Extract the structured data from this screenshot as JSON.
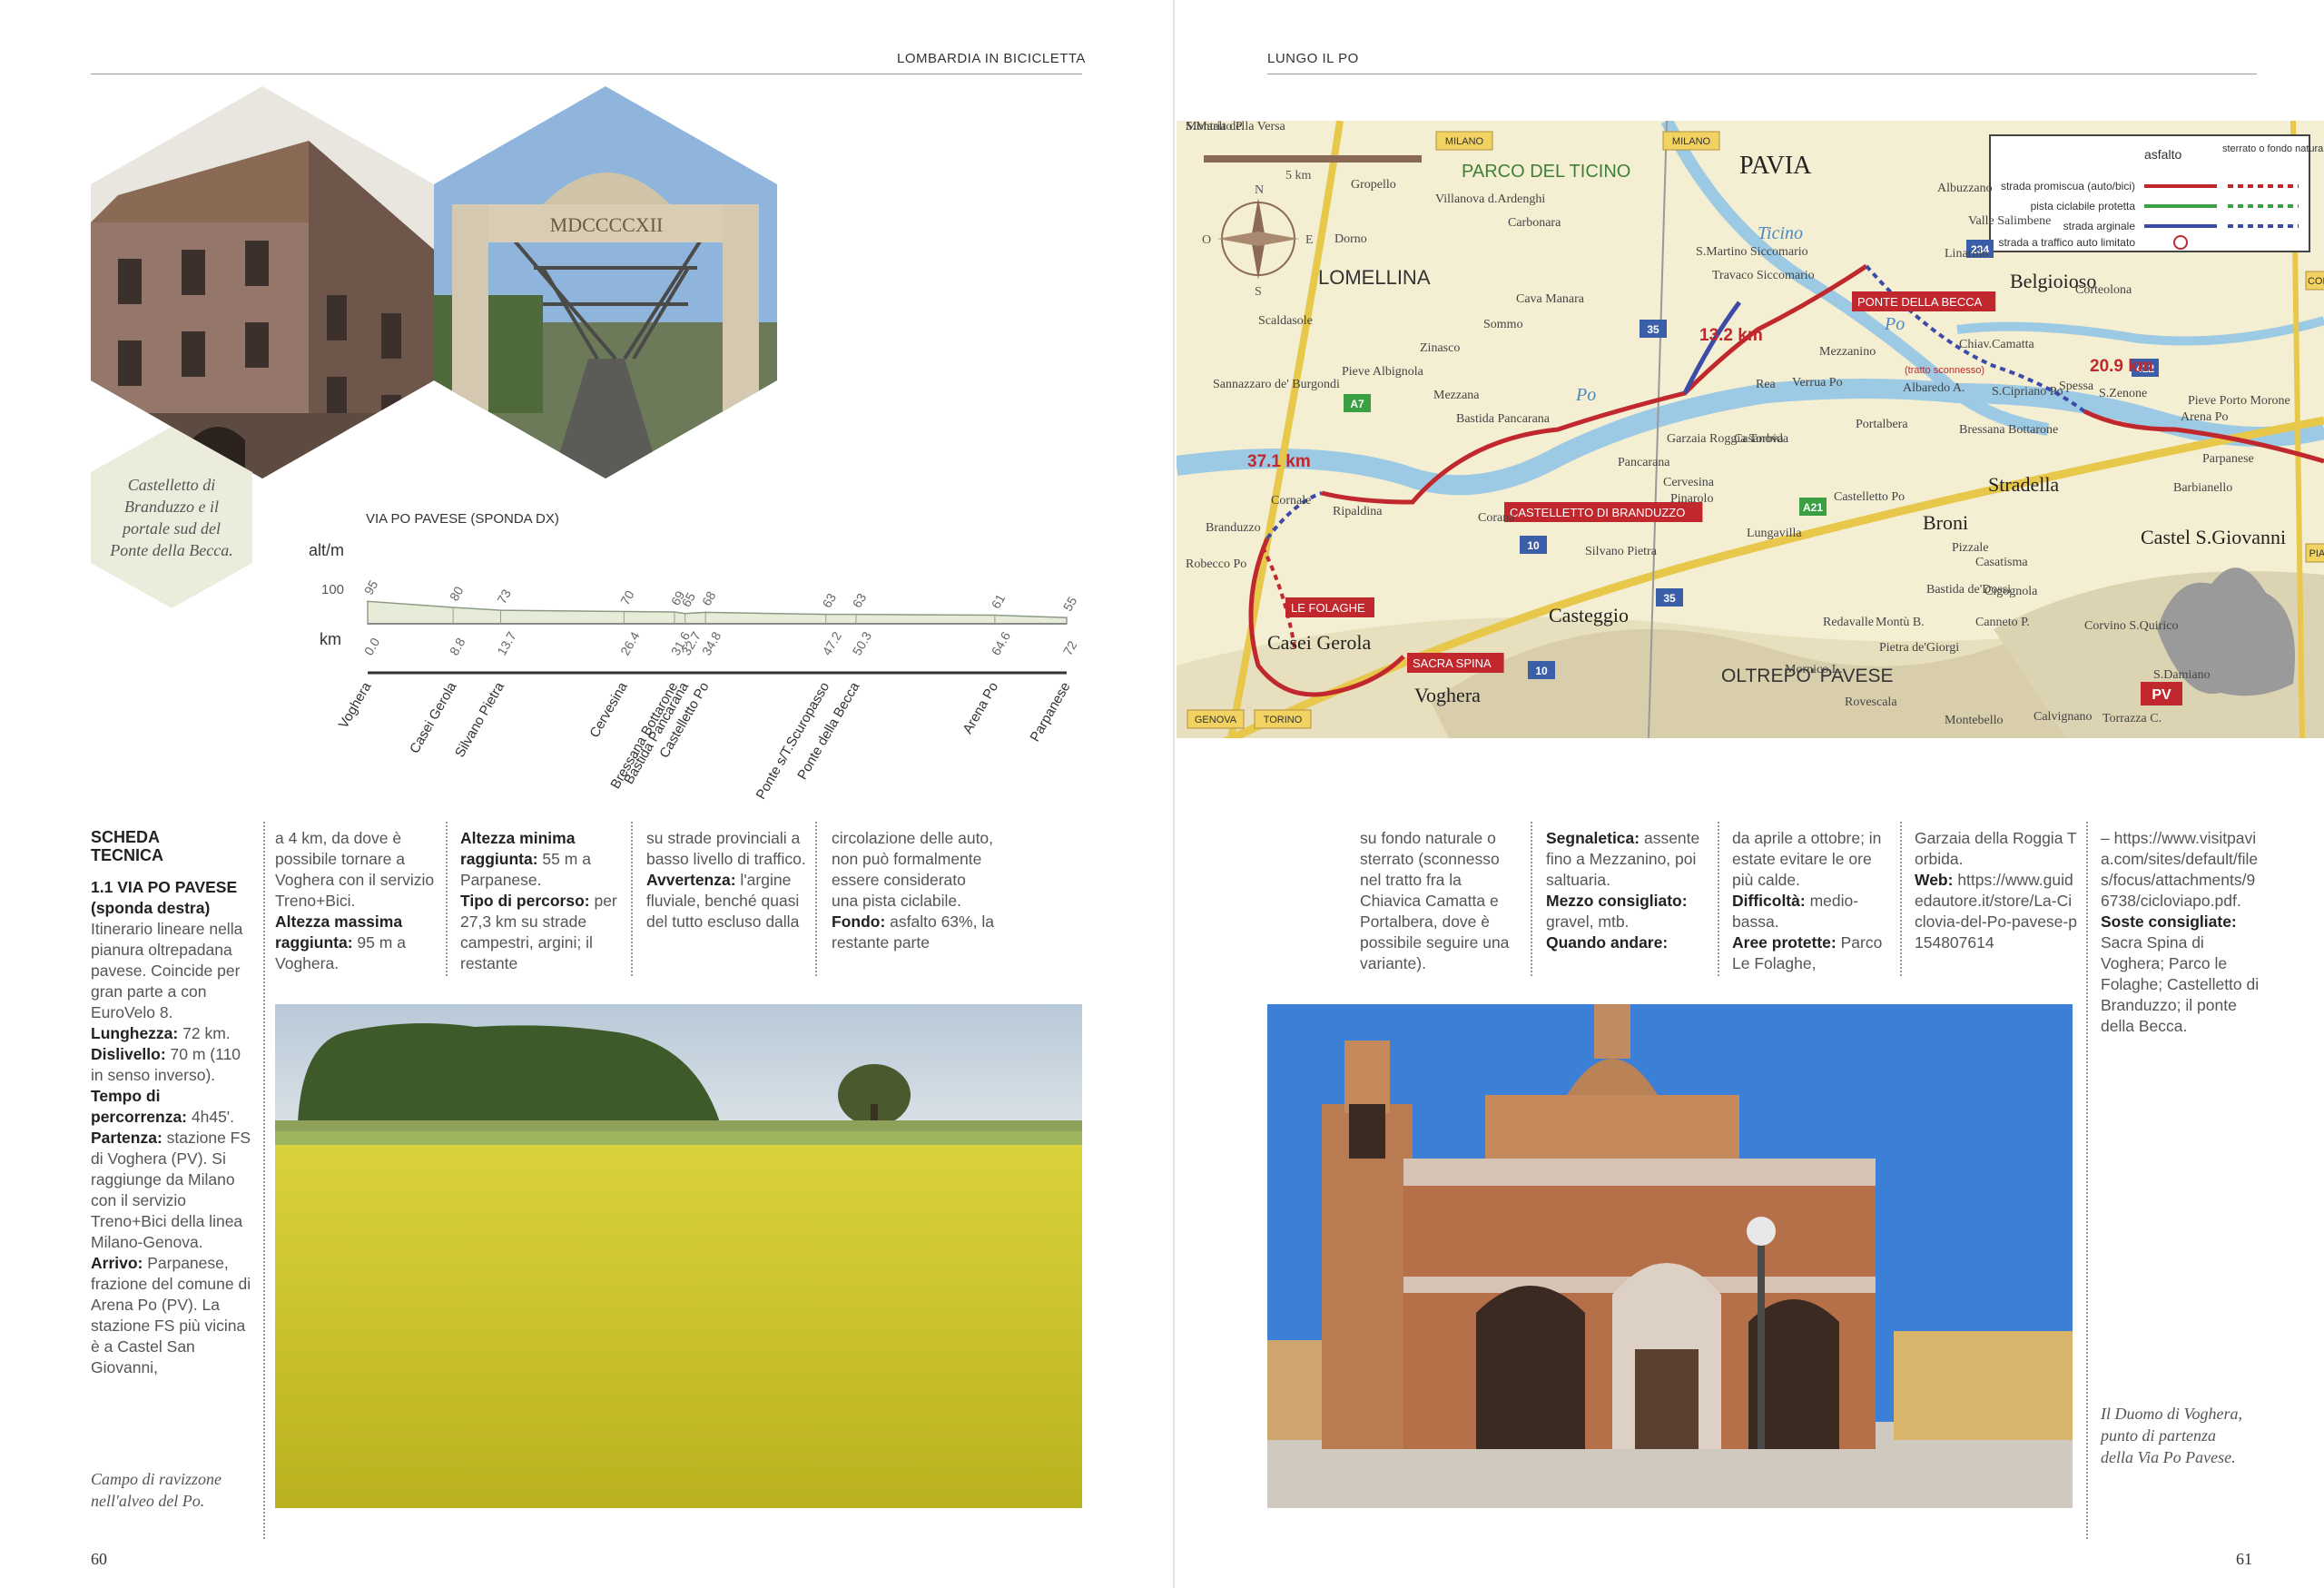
{
  "left_page": {
    "running_head": "LOMBARDIA IN BICICLETTA",
    "folio": "60",
    "photo_caption": "Castelletto di Branduzzo e il portale sud del Ponte della Becca.",
    "portal_inscription": "MDCCCCXII",
    "bottom_caption": "Campo di ravizzone nell'alveo del Po."
  },
  "right_page": {
    "running_head": "LUNGO IL PO",
    "folio": "61",
    "bottom_caption": "Il Duomo di Voghera, punto di partenza della Via Po Pavese."
  },
  "profile": {
    "title": "VIA PO PAVESE (SPONDA DX)",
    "y_label": "alt/m",
    "y_tick": "100",
    "x_label": "km",
    "points": [
      {
        "place": "Voghera",
        "km": "0.0",
        "alt": "95"
      },
      {
        "place": "Casei Gerola",
        "km": "8.8",
        "alt": "80"
      },
      {
        "place": "Silvano Pietra",
        "km": "13.7",
        "alt": "73"
      },
      {
        "place": "Cervesina",
        "km": "26.4",
        "alt": "70"
      },
      {
        "place": "Bastida Pancarana",
        "km": "32.7",
        "alt": "65"
      },
      {
        "place": "Castelletto Po",
        "km": "34.8",
        "alt": "68"
      },
      {
        "place": "Bressana Bottarone",
        "km": "31.6",
        "alt": "69"
      },
      {
        "place": "Ponte s/T.Scuropasso",
        "km": "47.2",
        "alt": "63"
      },
      {
        "place": "Ponte della Becca",
        "km": "50.3",
        "alt": "63"
      },
      {
        "place": "Arena Po",
        "km": "64.6",
        "alt": "61"
      },
      {
        "place": "Parpanese",
        "km": "72",
        "alt": "55"
      }
    ]
  },
  "scheda": {
    "heading": "SCHEDA TECNICA",
    "route_title": "1.1 VIA PO PAVESE (sponda destra)",
    "intro": "Itinerario lineare nella pianura oltrepadana pavese. Coincide per gran parte a con EuroVelo 8.",
    "lunghezza_label": "Lunghezza:",
    "lunghezza": " 72 km.",
    "dislivello_label": "Dislivello:",
    "dislivello": " 70 m (110 in senso inverso).",
    "tempo_label": "Tempo di percorrenza:",
    "tempo": " 4h45'.",
    "partenza_label": "Partenza:",
    "partenza": " stazione FS di Voghera (PV). Si raggiunge da Milano con il servizio Treno+Bici della linea Milano-Genova.",
    "arrivo_label": "Arrivo:",
    "arrivo": " Parpanese, frazione del comune di Arena Po (PV). La stazione FS più vicina è a Castel San Giovanni,",
    "col2_text": "a 4 km, da dove è possibile tornare a Voghera con il servizio Treno+Bici.",
    "altezza_max_label": "Altezza massima raggiunta:",
    "altezza_max": " 95 m a Voghera.",
    "altezza_min_label": "Altezza minima raggiunta:",
    "altezza_min": " 55 m a Parpanese.",
    "tipo_label": "Tipo di percorso:",
    "tipo": " per 27,3 km su strade campestri, argini; il restante",
    "col4_text": "su strade provinciali a basso livello di traffico.",
    "avvertenza_label": "Avvertenza:",
    "avvertenza": " l'argine fluviale, benché quasi del tutto escluso dalla",
    "col5_text": "circolazione delle auto, non può formalmente essere considerato una pista ciclabile.",
    "fondo_label": "Fondo:",
    "fondo": " asfalto 63%, la restante parte",
    "col6_text": "su fondo naturale o sterrato (sconnesso nel tratto fra la Chiavica Camatta e Portalbera, dove è possibile seguire una variante).",
    "segnaletica_label": "Segnaletica:",
    "segnaletica": " assente fino a Mezzanino, poi saltuaria.",
    "mezzo_label": "Mezzo consigliato:",
    "mezzo": " gravel, mtb.",
    "quando_label": "Quando andare:",
    "col8_text": "da aprile a ottobre; in estate evitare le ore più calde.",
    "difficolta_label": "Difficoltà:",
    "difficolta": " medio-bassa.",
    "aree_label": "Aree protette:",
    "aree": " Parco Le Folaghe,",
    "col9_text": "Garzaia della Roggia Torbida.",
    "web_label": "Web:",
    "web": " https://www.guidedautore.it/store/La-Ciclovia-del-Po-pavese-p154807614",
    "col10_text": "– https://www.visitpavia.com/sites/default/files/focus/attachments/96738/cicloviapo.pdf.",
    "soste_label": "Soste consigliate:",
    "soste": " Sacra Spina di Voghera; Parco le Folaghe; Castelletto di Branduzzo; il ponte della Becca."
  },
  "map": {
    "legend": {
      "col_asfalto": "asfalto",
      "col_sterrato": "sterrato o fondo naturale",
      "rows": [
        {
          "label": "strada promiscua (auto/bici)",
          "color": "#c0282d"
        },
        {
          "label": "pista ciclabile protetta",
          "color": "#3aa043"
        },
        {
          "label": "strada arginale",
          "color": "#3c4aa8"
        },
        {
          "label": "strada a traffico auto limitato",
          "color": "#c0282d"
        }
      ]
    },
    "scale": "5 km",
    "compass": [
      "N",
      "E",
      "S",
      "O"
    ],
    "region_badge": "PV",
    "edge_labels": [
      "MILANO",
      "MILANO",
      "GENOVA",
      "TORINO",
      "CODOGNO",
      "PIACENZA"
    ],
    "road_numbers": [
      "35",
      "234",
      "412",
      "A7",
      "A21",
      "10",
      "35",
      "10"
    ],
    "distances": [
      "37.1 km",
      "13.2 km",
      "20.9 km"
    ],
    "red_labels": [
      "PONTE DELLA BECCA",
      "CASTELLETTO DI BRANDUZZO",
      "LE FOLAGHE",
      "SACRA SPINA"
    ],
    "regions": [
      "PARCO DEL TICINO",
      "LOMELLINA",
      "OLTREPO' PAVESE"
    ],
    "rivers": [
      "Ticino",
      "Po",
      "Po"
    ],
    "big_towns": [
      "PAVIA",
      "Belgioioso",
      "Stradella",
      "Broni",
      "Casteggio",
      "Voghera",
      "Casei Gerola",
      "Castel S.Giovanni"
    ],
    "towns": [
      "Gropello",
      "Villanova d.Ardenghi",
      "Carbonara",
      "Dorno",
      "Albuzzano",
      "Valle Salimbene",
      "Linarolo",
      "S.Martino Siccomario",
      "Travaco Siccomario",
      "Corteolona",
      "Scaldasole",
      "Cava Manara",
      "Sommo",
      "Zinasco",
      "Pieve Albignola",
      "Sannazzaro de' Burgondi",
      "Mezzana",
      "Mezzanino",
      "Chiav.Camatta",
      "Rea",
      "Verrua Po",
      "Albaredo A.",
      "S.Cipriano Po",
      "Spessa",
      "S.Zenone",
      "Pieve Porto Morone",
      "Arena Po",
      "Parpanese",
      "Bastida Pancarana",
      "Garzaia Roggia Torbida",
      "Casanova",
      "Portalbera",
      "Pancarana",
      "Bressana Bottarone",
      "Barbianello",
      "Ripaldina",
      "Corana",
      "Cervesina",
      "Castelletto Po",
      "Branduzzo",
      "Pinarolo",
      "Cornale",
      "Lungavilla",
      "Robecco Po",
      "Silvano Pietra",
      "Casatisma",
      "Pizzale",
      "Bastida de'Dossi",
      "Cigognola",
      "Canneto P.",
      "Redavalle",
      "Montù B.",
      "Corvino S.Quirico",
      "Pietra de'Giorgi",
      "S.Damiano",
      "Mornico L.",
      "Rovescala",
      "Montebello",
      "Calvignano",
      "Torrazza C.",
      "Montalto P.",
      "S.Maria della Versa"
    ],
    "tratto": "(tratto sconnesso)"
  }
}
